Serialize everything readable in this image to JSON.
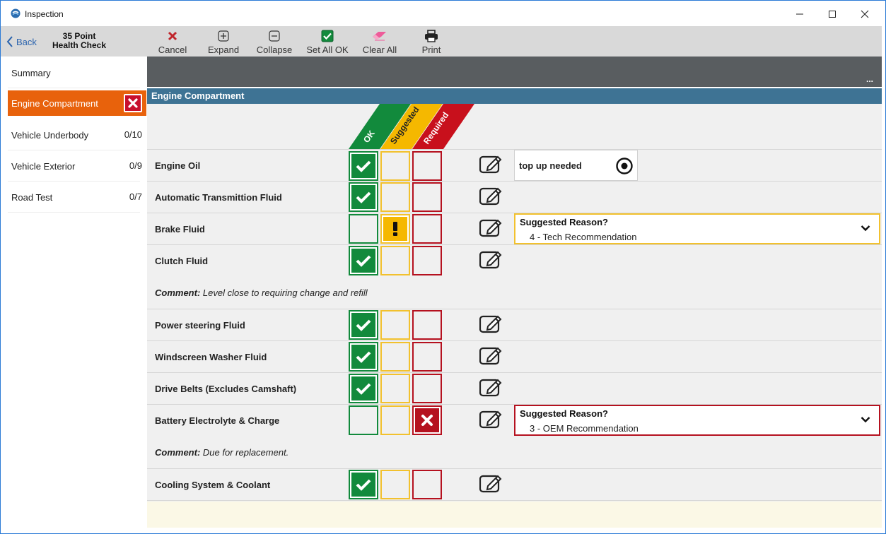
{
  "window": {
    "title": "Inspection"
  },
  "sidebar": {
    "back_label": "Back",
    "check_title_line1": "35 Point",
    "check_title_line2": "Health Check",
    "items": [
      {
        "label": "Summary",
        "count": ""
      },
      {
        "label": "Engine Compartment",
        "count": "",
        "status": "required"
      },
      {
        "label": "Vehicle Underbody",
        "count": "0/10"
      },
      {
        "label": "Vehicle Exterior",
        "count": "0/9"
      },
      {
        "label": "Road Test",
        "count": "0/7"
      }
    ]
  },
  "toolbar": {
    "cancel_label": "Cancel",
    "expand_label": "Expand",
    "collapse_label": "Collapse",
    "set_all_ok_label": "Set All OK",
    "clear_all_label": "Clear All",
    "print_label": "Print"
  },
  "darkbar": {
    "more_label": "..."
  },
  "section": {
    "title": "Engine Compartment",
    "column_headers": {
      "ok": "OK",
      "suggested": "Suggested",
      "required": "Required"
    }
  },
  "colors": {
    "ok": "#128a3c",
    "suggested": "#f5b800",
    "required": "#b5111f",
    "active": "#e8620c",
    "header": "#3e7394"
  },
  "rows": [
    {
      "name": "Engine Oil",
      "status": "ok",
      "note": "top up needed"
    },
    {
      "name": "Automatic Transmittion Fluid",
      "status": "ok"
    },
    {
      "name": "Brake Fluid",
      "status": "suggested",
      "reason_title": "Suggested Reason?",
      "reason_value": "4 - Tech Recommendation"
    },
    {
      "name": "Clutch Fluid",
      "status": "ok",
      "comment_label": "Comment:",
      "comment": "Level close to requiring change and refill"
    },
    {
      "name": "Power steering Fluid",
      "status": "ok"
    },
    {
      "name": "Windscreen Washer Fluid",
      "status": "ok"
    },
    {
      "name": "Drive Belts (Excludes Camshaft)",
      "status": "ok"
    },
    {
      "name": "Battery Electrolyte & Charge",
      "status": "required",
      "reason_title": "Suggested Reason?",
      "reason_value": "3 - OEM Recommendation",
      "comment_label": "Comment:",
      "comment": "Due for replacement."
    },
    {
      "name": "Cooling System & Coolant",
      "status": "ok"
    }
  ]
}
